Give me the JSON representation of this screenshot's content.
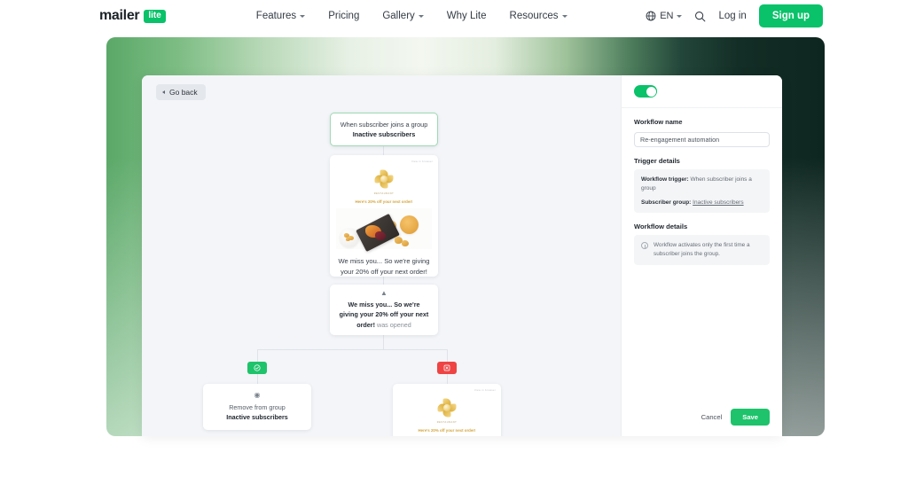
{
  "nav": {
    "logo_text": "mailer",
    "logo_badge": "lite",
    "links": [
      {
        "label": "Features",
        "has_caret": true
      },
      {
        "label": "Pricing",
        "has_caret": false
      },
      {
        "label": "Gallery",
        "has_caret": true
      },
      {
        "label": "Why Lite",
        "has_caret": false
      },
      {
        "label": "Resources",
        "has_caret": true
      }
    ],
    "language": "EN",
    "login_label": "Log in",
    "signup_label": "Sign up"
  },
  "canvas": {
    "go_back_label": "Go back",
    "trigger_node": {
      "text_prefix": "When subscriber joins a group ",
      "text_bold": "Inactive subscribers"
    },
    "email_node": {
      "top_label": "View in browser",
      "brand_sub": "RESTAURANT",
      "promo_line": "Here's 20% off your next order!",
      "caption": "We miss you... So we're giving your 20% off your next order!"
    },
    "condition_node": {
      "icon": "branch-icon",
      "text_bold": "We miss you... So we're giving your 20% off your next order!",
      "text_suffix": " was opened"
    },
    "branch_yes_label": "yes",
    "branch_no_label": "no",
    "remove_node": {
      "icon": "group-icon",
      "text_prefix": "Remove from group ",
      "text_bold": "Inactive subscribers"
    },
    "email_node_2": {
      "top_label": "View in browser",
      "brand_sub": "RESTAURANT",
      "promo_line": "Here's 20% off your next order!"
    }
  },
  "panel": {
    "toggle_on": true,
    "workflow_name_label": "Workflow name",
    "workflow_name_value": "Re-engagement automation",
    "trigger_details_title": "Trigger details",
    "trigger_key_1": "Workflow trigger:",
    "trigger_val_1": " When subscriber joins a group",
    "trigger_key_2": "Subscriber group:",
    "trigger_val_2": "Inactive subscribers",
    "workflow_details_title": "Workflow details",
    "workflow_info": "Workflow activates only the first time a subscriber joins the group.",
    "cancel_label": "Cancel",
    "save_label": "Save"
  },
  "colors": {
    "brand_green": "#09C269",
    "save_green": "#1ec36b",
    "badge_red": "#ef4444",
    "dark_green": "#0e2620"
  }
}
